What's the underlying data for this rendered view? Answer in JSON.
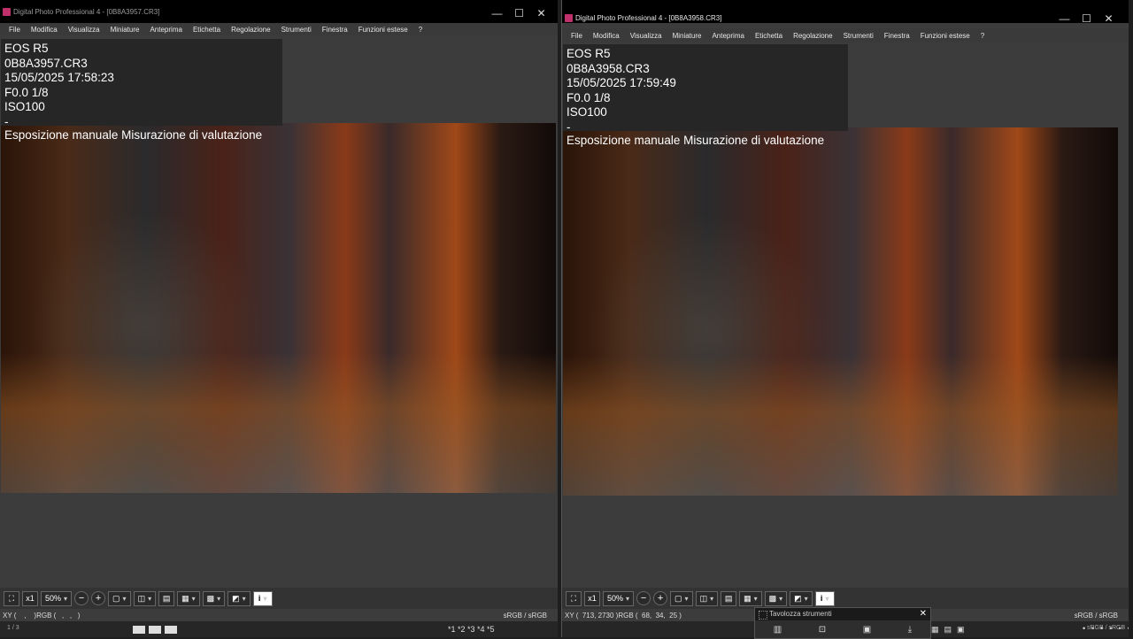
{
  "left": {
    "title": "Digital Photo Professional 4 - [0B8A3957.CR3]",
    "menu": [
      "File",
      "Modifica",
      "Visualizza",
      "Miniature",
      "Anteprima",
      "Etichetta",
      "Regolazione",
      "Strumenti",
      "Finestra",
      "Funzioni estese",
      "?"
    ],
    "info": {
      "camera": "EOS R5",
      "file": "0B8A3957.CR3",
      "datetime": "15/05/2025 17:58:23",
      "exposure": "F0.0 1/8",
      "iso": "ISO100",
      "dash": "-"
    },
    "mode": "Esposizione manuale Misurazione di valutazione",
    "zoom_x1": "x1",
    "zoom": "50%",
    "xy": "XY (    ,    )RGB (   ,   ,   )",
    "colorspace": "sRGB / sRGB"
  },
  "right": {
    "title": "Digital Photo Professional 4 - [0B8A3958.CR3]",
    "menu": [
      "File",
      "Modifica",
      "Visualizza",
      "Miniature",
      "Anteprima",
      "Etichetta",
      "Regolazione",
      "Strumenti",
      "Finestra",
      "Funzioni estese",
      "?"
    ],
    "info": {
      "camera": "EOS R5",
      "file": "0B8A3958.CR3",
      "datetime": "15/05/2025 17:59:49",
      "exposure": "F0.0 1/8",
      "iso": "ISO100",
      "dash": "-"
    },
    "mode": "Esposizione manuale Misurazione di valutazione",
    "zoom_x1": "x1",
    "zoom": "50%",
    "xy": "XY (  713, 2730 )RGB (  68,  34,  25 )",
    "colorspace": "sRGB / sRGB"
  },
  "taskbar": {
    "page_count": "1 / 3",
    "stars": "*1 *2 *3 *4 *5",
    "colorspace": "sRGB / sRGB"
  },
  "tool_palette": {
    "title": "Tavolozza strumenti"
  },
  "icons": {
    "fit": "fit-window-icon",
    "zoom_out": "−",
    "zoom_in": "+",
    "info": "i",
    "close": "✕",
    "minimize": "—",
    "maximize": "☐"
  }
}
